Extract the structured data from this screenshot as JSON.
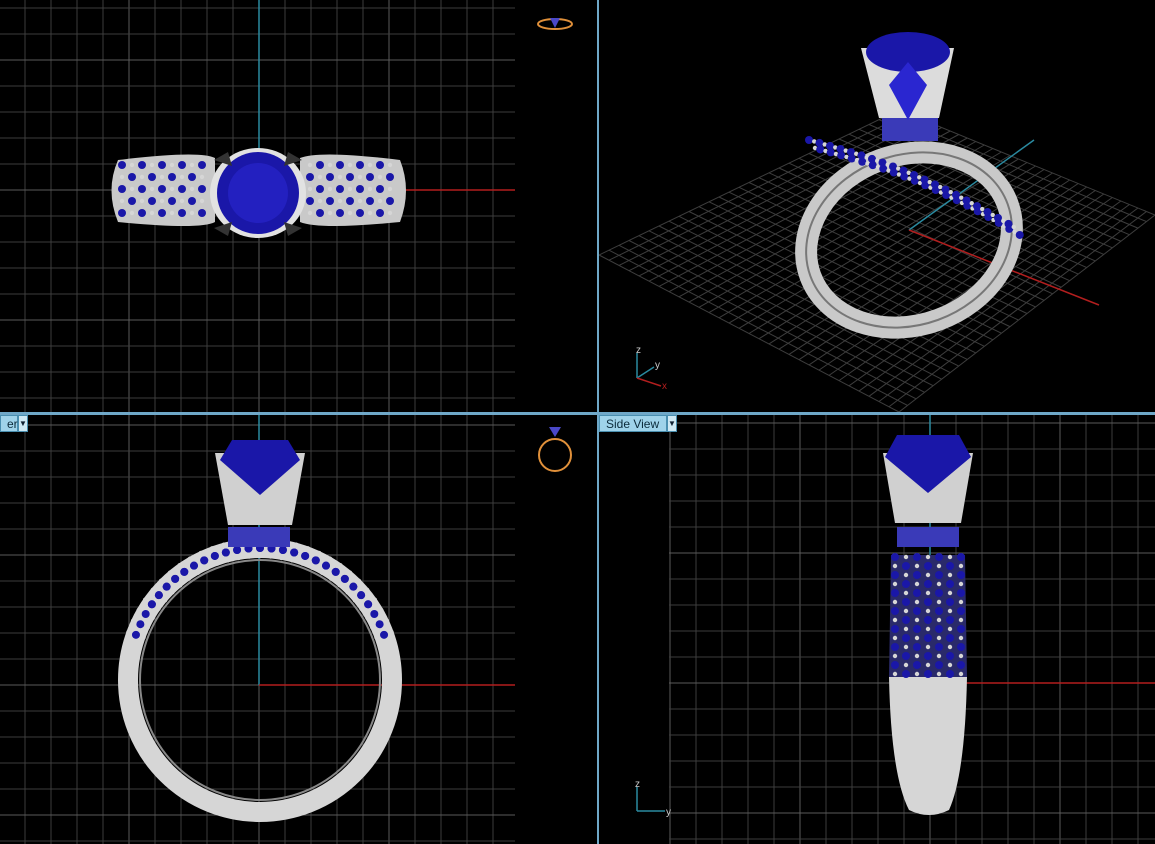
{
  "viewports": {
    "top": {
      "tab_label": ""
    },
    "perspective": {
      "tab_label": ""
    },
    "front": {
      "tab_label": "er"
    },
    "right": {
      "tab_label": "Side View"
    }
  },
  "axis_icon_labels": {
    "perspective": {
      "z": "z",
      "y": "y",
      "x": "x"
    },
    "right": {
      "z": "z",
      "y": "y"
    }
  },
  "colors": {
    "grid": "#3d3d3d",
    "grid_major": "#5a5a5a",
    "x_axis": "#b21e1e",
    "y_axis": "#2a8aa0",
    "gem": "#1a17a8",
    "metal": "#d6d6d6",
    "divider": "#6fa8c8",
    "tab": "#9fd3ea",
    "ring_icon": "#e0903a"
  },
  "icons": [
    "top-view-ring-icon",
    "front-view-ring-icon",
    "viewport-menu-arrow-icon"
  ]
}
